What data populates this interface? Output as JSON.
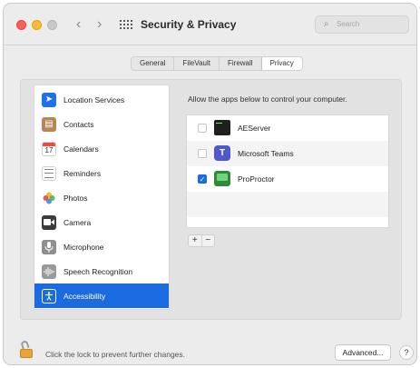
{
  "window": {
    "title": "Security & Privacy",
    "search_placeholder": "Search",
    "nav_back": "‹",
    "nav_forward": "›"
  },
  "tabs": [
    {
      "label": "General",
      "active": false
    },
    {
      "label": "FileVault",
      "active": false
    },
    {
      "label": "Firewall",
      "active": false
    },
    {
      "label": "Privacy",
      "active": true
    }
  ],
  "sidebar": {
    "items": [
      {
        "label": "Location Services",
        "icon": "location-arrow-icon"
      },
      {
        "label": "Contacts",
        "icon": "contacts-book-icon"
      },
      {
        "label": "Calendars",
        "icon": "calendar-icon",
        "icon_text": "17"
      },
      {
        "label": "Reminders",
        "icon": "reminders-list-icon"
      },
      {
        "label": "Photos",
        "icon": "photos-flower-icon"
      },
      {
        "label": "Camera",
        "icon": "camera-icon"
      },
      {
        "label": "Microphone",
        "icon": "microphone-icon"
      },
      {
        "label": "Speech Recognition",
        "icon": "waveform-icon"
      },
      {
        "label": "Accessibility",
        "icon": "accessibility-icon",
        "selected": true
      }
    ]
  },
  "main": {
    "description": "Allow the apps below to control your computer.",
    "apps": [
      {
        "name": "AEServer",
        "checked": false,
        "icon": "terminal-app-icon"
      },
      {
        "name": "Microsoft Teams",
        "checked": false,
        "icon": "teams-app-icon",
        "icon_text": "T"
      },
      {
        "name": "ProProctor",
        "checked": true,
        "icon": "proproctor-app-icon",
        "check_mark": "✓"
      }
    ],
    "add_label": "+",
    "remove_label": "−"
  },
  "footer": {
    "lock_text": "Click the lock to prevent further changes.",
    "advanced_label": "Advanced...",
    "help_label": "?"
  },
  "colors": {
    "accent": "#1a6ae0",
    "window_bg": "#ececec",
    "selected_row": "#1a6ae0"
  }
}
